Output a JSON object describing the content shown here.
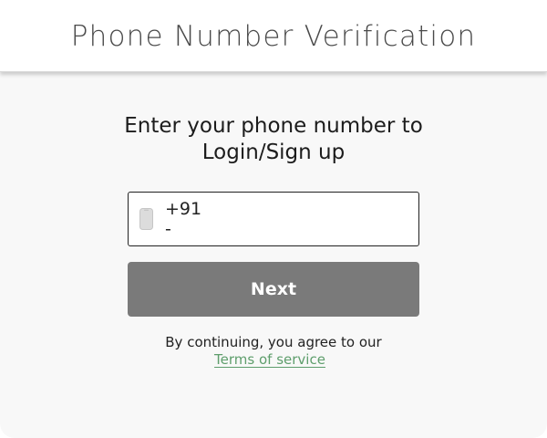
{
  "header": {
    "title": "Phone Number Verification"
  },
  "prompt": {
    "line1": "Enter your phone number to",
    "line2": "Login/Sign up"
  },
  "phone_field": {
    "icon": "mobile-phone-icon",
    "country_code": "+91 -",
    "value": "",
    "placeholder": ""
  },
  "actions": {
    "next_label": "Next"
  },
  "legal": {
    "text": "By continuing, you agree to our",
    "link_label": "Terms of service"
  },
  "colors": {
    "button_bg": "#7a7a7a",
    "link": "#5e9e6c",
    "panel_bg": "#f8f8f8"
  }
}
